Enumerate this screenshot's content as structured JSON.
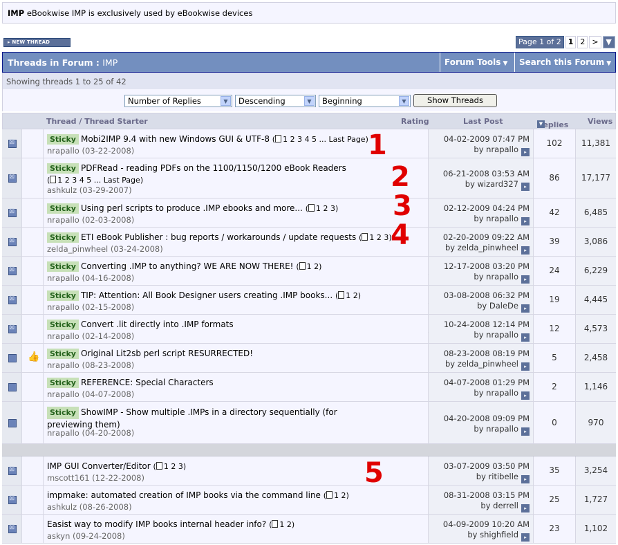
{
  "description": {
    "forum": "IMP",
    "text": "eBookwise IMP is exclusively used by eBookwise devices"
  },
  "new_thread_label": "NEW THREAD",
  "pagenav": {
    "label": "Page 1 of 2",
    "current": "1",
    "next": "2",
    "next_arrow": ">",
    "menu": "▼"
  },
  "header": {
    "title": "Threads in Forum",
    "sep": ":",
    "forum": "IMP",
    "tools": "Forum Tools",
    "search": "Search this Forum",
    "caret": "▼"
  },
  "showing": "Showing threads 1 to 25 of 42",
  "sort": {
    "field": "Number of Replies",
    "order": "Descending",
    "from": "Beginning",
    "button": "Show Threads"
  },
  "columns": {
    "thread": "Thread / Thread Starter",
    "rating": "Rating",
    "last_post": "Last Post",
    "replies": "Replies",
    "views": "Views"
  },
  "sticky_label": "Sticky",
  "stars": "☆☆☆☆☆",
  "threads": [
    {
      "title": "Mobi2IMP 9.4 with new Windows GUI & UTF-8",
      "pages": "1 2 3 4 5 ... Last Page",
      "starter": "nrapallo (03-22-2008)",
      "date": "04-02-2009 07:47 PM",
      "by": "by nrapallo",
      "replies": "102",
      "views": "11,381"
    },
    {
      "title": "PDFRead - reading PDFs on the 1100/1150/1200 eBook Readers",
      "pages": "1 2 3 4 5 ... Last Page",
      "starter": "ashkulz (03-29-2007)",
      "date": "06-21-2008 03:53 AM",
      "by": "by wizard327",
      "replies": "86",
      "views": "17,177"
    },
    {
      "title": "Using perl scripts to produce .IMP ebooks and more...",
      "pages": "1 2 3",
      "starter": "nrapallo (02-03-2008)",
      "date": "02-12-2009 04:24 PM",
      "by": "by nrapallo",
      "replies": "42",
      "views": "6,485"
    },
    {
      "title": "ETI eBook Publisher : bug reports / workarounds / update requests",
      "pages": "1 2 3",
      "starter": "zelda_pinwheel (03-24-2008)",
      "date": "02-20-2009 09:22 AM",
      "by": "by zelda_pinwheel",
      "replies": "39",
      "views": "3,086"
    },
    {
      "title": "Converting .IMP to anything? WE ARE NOW THERE!",
      "pages": "1 2",
      "starter": "nrapallo (04-16-2008)",
      "date": "12-17-2008 03:20 PM",
      "by": "by nrapallo",
      "replies": "24",
      "views": "6,229"
    },
    {
      "title": "TIP: Attention: All Book Designer users creating .IMP books...",
      "pages": "1 2",
      "starter": "nrapallo (02-15-2008)",
      "date": "03-08-2008 06:32 PM",
      "by": "by DaleDe",
      "replies": "19",
      "views": "4,445"
    },
    {
      "title": "Convert .lit directly into .IMP formats",
      "pages": "",
      "starter": "nrapallo (02-14-2008)",
      "date": "10-24-2008 12:14 PM",
      "by": "by nrapallo",
      "replies": "12",
      "views": "4,573"
    },
    {
      "title": "Original Lit2sb perl script RESURRECTED!",
      "pages": "",
      "starter": "nrapallo (08-23-2008)",
      "date": "08-23-2008 08:19 PM",
      "by": "by zelda_pinwheel",
      "replies": "5",
      "views": "2,458"
    },
    {
      "title": "REFERENCE: Special Characters",
      "pages": "",
      "starter": "nrapallo (04-07-2008)",
      "date": "04-07-2008 01:29 PM",
      "by": "by nrapallo",
      "replies": "2",
      "views": "1,146"
    },
    {
      "title": "ShowIMP - Show multiple .IMPs in a directory sequentially (for previewing them)",
      "pages": "",
      "starter": "nrapallo (04-20-2008)",
      "date": "04-20-2008 09:09 PM",
      "by": "by nrapallo",
      "replies": "0",
      "views": "970"
    },
    {
      "title": "IMP GUI Converter/Editor",
      "pages": "1 2 3",
      "starter": "mscott161 (12-22-2008)",
      "date": "03-07-2009 03:50 PM",
      "by": "by ritibelle",
      "replies": "35",
      "views": "3,254"
    },
    {
      "title": "impmake: automated creation of IMP books via the command line",
      "pages": "1 2",
      "starter": "ashkulz (08-26-2008)",
      "date": "08-31-2008 03:15 PM",
      "by": "by derrell",
      "replies": "25",
      "views": "1,727"
    },
    {
      "title": "Easist way to modify IMP books internal header info?",
      "pages": "1 2",
      "starter": "askyn (09-24-2008)",
      "date": "04-09-2009 10:20 AM",
      "by": "by shighfield",
      "replies": "23",
      "views": "1,102"
    }
  ],
  "annotations": [
    "1",
    "2",
    "3",
    "4",
    "5"
  ]
}
